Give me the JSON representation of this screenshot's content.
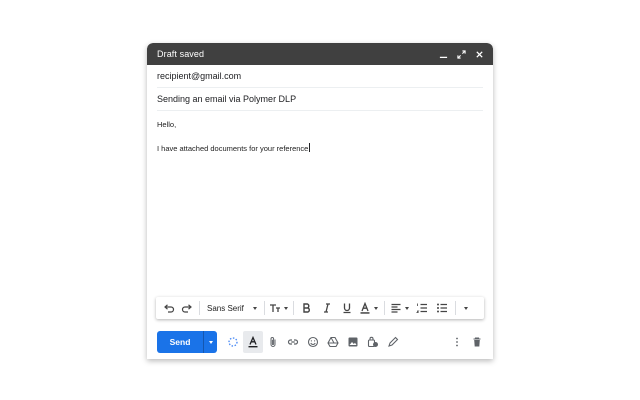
{
  "window": {
    "title": "Draft saved",
    "controls": [
      "minimize-icon",
      "expand-icon",
      "close-icon"
    ]
  },
  "fields": {
    "to": "recipient@gmail.com",
    "subject": "Sending an email via Polymer DLP"
  },
  "message": {
    "greeting": "Hello,",
    "line": "I have attached documents for your reference"
  },
  "format_toolbar": {
    "font": "Sans Serif",
    "icons": [
      "undo-icon",
      "redo-icon",
      "font-size-icon",
      "bold-icon",
      "italic-icon",
      "underline-icon",
      "text-color-icon",
      "align-icon",
      "numbered-list-icon",
      "bulleted-list-icon",
      "more-formatting-icon"
    ]
  },
  "bottom_bar": {
    "send_label": "Send",
    "icons": [
      "loading-icon",
      "formatting-options-icon",
      "attach-icon",
      "link-icon",
      "emoji-icon",
      "drive-icon",
      "photo-icon",
      "confidential-icon",
      "signature-icon",
      "more-options-icon",
      "discard-icon"
    ]
  },
  "colors": {
    "titlebar": "#404040",
    "send_button": "#1a73e8"
  }
}
